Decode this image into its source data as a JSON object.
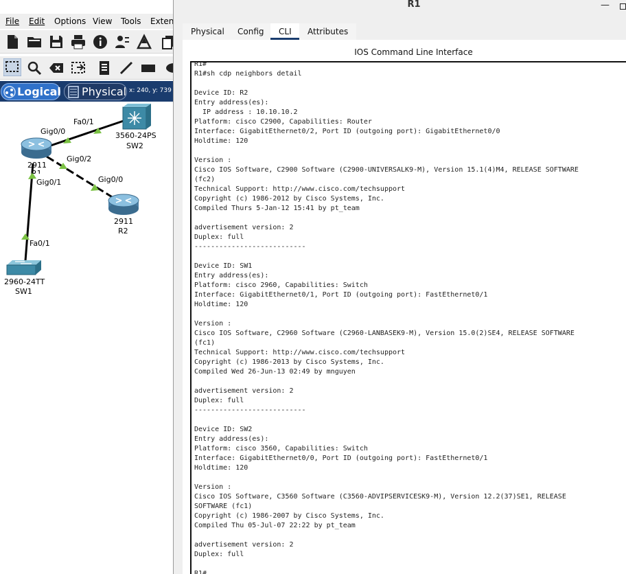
{
  "menu": {
    "items": [
      {
        "label": "File"
      },
      {
        "label": "Edit"
      },
      {
        "label": "Options"
      },
      {
        "label": "View"
      },
      {
        "label": "Tools"
      },
      {
        "label": "Extens"
      }
    ]
  },
  "toolbar": {
    "icons": [
      "new-file-icon",
      "open-folder-icon",
      "save-icon",
      "print-icon",
      "info-icon",
      "user-network-icon",
      "activity-wizard-icon",
      "copy-icon"
    ]
  },
  "edit_toolbar": {
    "icons": [
      "select-icon",
      "inspect-icon",
      "delete-icon",
      "resize-icon",
      "note-icon",
      "line-icon",
      "rectangle-icon",
      "ellipse-icon"
    ]
  },
  "modes": {
    "logical": "Logical",
    "physical": "Physical",
    "coords": "x: 240, y: 739"
  },
  "topology": {
    "links": [
      {
        "from": "R1",
        "to": "SW2",
        "from_port": "Gig0/0",
        "to_port": "Fa0/1",
        "style": "solid"
      },
      {
        "from": "R1",
        "to": "R2",
        "from_port": "Gig0/2",
        "to_port": "Gig0/0",
        "style": "dashed"
      },
      {
        "from": "R1",
        "to": "SW1",
        "from_port": "Gig0/1",
        "to_port": "Fa0/1",
        "style": "solid"
      }
    ],
    "devices": {
      "r1": {
        "model": "2911",
        "name": "R1"
      },
      "r2": {
        "model": "2911",
        "name": "R2"
      },
      "sw2": {
        "model": "3560-24PS",
        "name": "SW2"
      },
      "sw1": {
        "model": "2960-24TT",
        "name": "SW1"
      }
    },
    "port_labels": {
      "r1_gig00": "Gig0/0",
      "sw2_fa01": "Fa0/1",
      "r1_gig02": "Gig0/2",
      "r2_gig00": "Gig0/0",
      "r1_gig01": "Gig0/1",
      "sw1_fa01": "Fa0/1"
    },
    "link_color": "#000000",
    "indicator_color": "#7ac143"
  },
  "window": {
    "title": "R1",
    "tabs": [
      {
        "label": "Physical"
      },
      {
        "label": "Config"
      },
      {
        "label": "CLI",
        "active": true
      },
      {
        "label": "Attributes"
      }
    ],
    "cli_title": "IOS Command Line Interface",
    "console": "R1#\nR1#sh cdp neighbors detail\n\nDevice ID: R2\nEntry address(es):\n  IP address : 10.10.10.2\nPlatform: cisco C2900, Capabilities: Router\nInterface: GigabitEthernet0/2, Port ID (outgoing port): GigabitEthernet0/0\nHoldtime: 120\n\nVersion :\nCisco IOS Software, C2900 Software (C2900-UNIVERSALK9-M), Version 15.1(4)M4, RELEASE SOFTWARE\n(fc2)\nTechnical Support: http://www.cisco.com/techsupport\nCopyright (c) 1986-2012 by Cisco Systems, Inc.\nCompiled Thurs 5-Jan-12 15:41 by pt_team\n\nadvertisement version: 2\nDuplex: full\n---------------------------\n\nDevice ID: SW1\nEntry address(es):\nPlatform: cisco 2960, Capabilities: Switch\nInterface: GigabitEthernet0/1, Port ID (outgoing port): FastEthernet0/1\nHoldtime: 120\n\nVersion :\nCisco IOS Software, C2960 Software (C2960-LANBASEK9-M), Version 15.0(2)SE4, RELEASE SOFTWARE\n(fc1)\nTechnical Support: http://www.cisco.com/techsupport\nCopyright (c) 1986-2013 by Cisco Systems, Inc.\nCompiled Wed 26-Jun-13 02:49 by mnguyen\n\nadvertisement version: 2\nDuplex: full\n---------------------------\n\nDevice ID: SW2\nEntry address(es):\nPlatform: cisco 3560, Capabilities: Switch\nInterface: GigabitEthernet0/0, Port ID (outgoing port): FastEthernet0/1\nHoldtime: 120\n\nVersion :\nCisco IOS Software, C3560 Software (C3560-ADVIPSERVICESK9-M), Version 12.2(37)SE1, RELEASE\nSOFTWARE (fc1)\nCopyright (c) 1986-2007 by Cisco Systems, Inc.\nCompiled Thu 05-Jul-07 22:22 by pt_team\n\nadvertisement version: 2\nDuplex: full\n\nR1#"
  },
  "colors": {
    "mode_bar": "#1a3c6e",
    "logical_active": "#2f71c9",
    "router_body": "#4a7fa6",
    "switch_body": "#3d8aa6"
  }
}
